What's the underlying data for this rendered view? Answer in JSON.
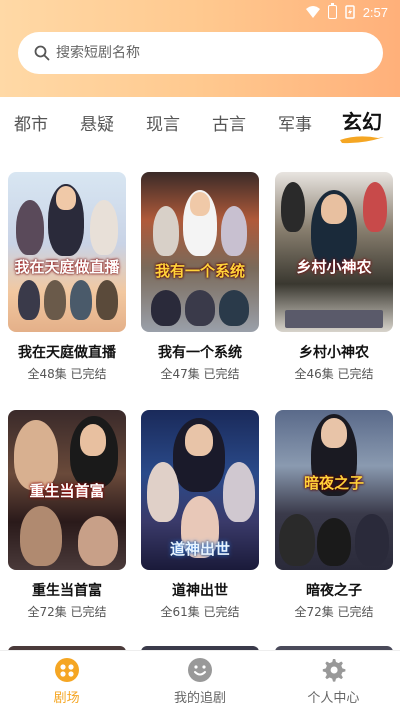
{
  "status_bar": {
    "time": "2:57"
  },
  "search": {
    "placeholder": "搜索短剧名称"
  },
  "tabs": [
    {
      "label": "都市",
      "active": false
    },
    {
      "label": "悬疑",
      "active": false
    },
    {
      "label": "现言",
      "active": false
    },
    {
      "label": "古言",
      "active": false
    },
    {
      "label": "军事",
      "active": false
    },
    {
      "label": "玄幻",
      "active": true
    }
  ],
  "dramas": [
    {
      "title": "我在天庭做直播",
      "meta": "全48集 已完结",
      "poster_text": "我在天庭做直播"
    },
    {
      "title": "我有一个系统",
      "meta": "全47集 已完结",
      "poster_text": "我有一个系统"
    },
    {
      "title": "乡村小神农",
      "meta": "全46集 已完结",
      "poster_text": "乡村小神农"
    },
    {
      "title": "重生当首富",
      "meta": "全72集 已完结",
      "poster_text": "重生当首富"
    },
    {
      "title": "道神出世",
      "meta": "全61集 已完结",
      "poster_text": "道神出世"
    },
    {
      "title": "暗夜之子",
      "meta": "全72集 已完结",
      "poster_text": "暗夜之子"
    }
  ],
  "bottom_nav": [
    {
      "label": "剧场",
      "icon": "theater-icon",
      "active": true
    },
    {
      "label": "我的追剧",
      "icon": "smiley-icon",
      "active": false
    },
    {
      "label": "个人中心",
      "icon": "gear-icon",
      "active": false
    }
  ],
  "colors": {
    "accent": "#f5a623",
    "header_start": "#ffd9a6",
    "header_end": "#ffb07a"
  }
}
